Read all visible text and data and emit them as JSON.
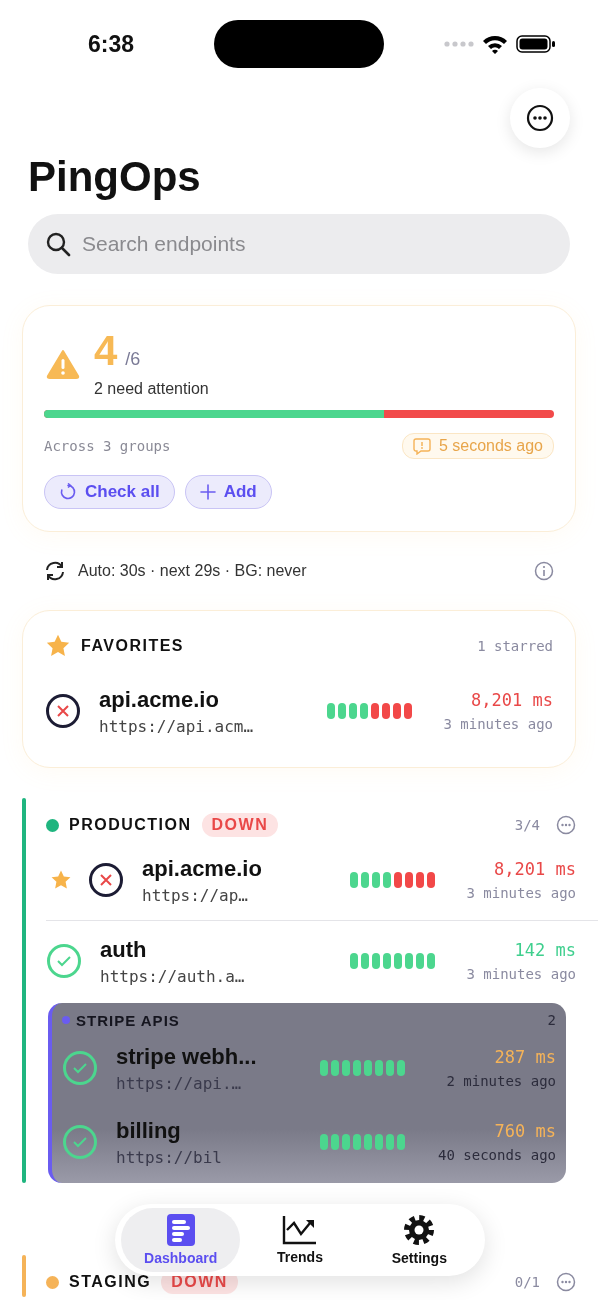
{
  "status_bar": {
    "time": "6:38"
  },
  "title": "PingOps",
  "search": {
    "placeholder": "Search endpoints"
  },
  "summary": {
    "count": "4",
    "total": "/6",
    "subtitle": "2 need attention",
    "level": 0.667,
    "groups": "Across 3 groups",
    "updated": "5 seconds ago",
    "buttons": [
      {
        "label": "Check all",
        "kind": "refresh"
      },
      {
        "label": "Add",
        "kind": "add"
      }
    ]
  },
  "auto_refresh": "Auto: 30s · next 29s · BG: never",
  "favorites": {
    "title": "FAVORITES",
    "count": "1 starred",
    "endpoints": [
      {
        "name": "api.acme.io",
        "url": "https://api.acm…",
        "down": true,
        "starred": false,
        "checks": [
          true,
          true,
          true,
          true,
          false,
          false,
          false,
          false
        ],
        "latency": "8,201 ms",
        "color": "#e94848",
        "ago": "3 minutes ago"
      }
    ]
  },
  "groups": [
    {
      "name": "PRODUCTION",
      "color": "#1fb57f",
      "badge": "DOWN",
      "count": "3/4",
      "endpoints": [
        {
          "name": "api.acme.io",
          "url": "https://ap…",
          "down": true,
          "starred": true,
          "checks": [
            true,
            true,
            true,
            true,
            false,
            false,
            false,
            false
          ],
          "latency": "8,201 ms",
          "color": "#e94848",
          "ago": "3 minutes ago"
        },
        {
          "name": "auth",
          "url": "https://auth.a…",
          "down": false,
          "starred": false,
          "checks": [
            true,
            true,
            true,
            true,
            true,
            true,
            true,
            true
          ],
          "latency": "142 ms",
          "color": "#3fcf8e",
          "ago": "3 minutes ago"
        }
      ],
      "subgroups": [
        {
          "name": "STRIPE APIS",
          "color": "#6a5cf0",
          "count": "2",
          "endpoints": [
            {
              "name": "stripe webh...",
              "url": "https://api.…",
              "down": false,
              "starred": false,
              "checks": [
                true,
                true,
                true,
                true,
                true,
                true,
                true,
                true
              ],
              "latency": "287 ms",
              "color": "#f5b358",
              "ago": "2 minutes ago"
            },
            {
              "name": "billing",
              "url": "https://bil",
              "down": false,
              "starred": false,
              "checks": [
                true,
                true,
                true,
                true,
                true,
                true,
                true,
                true
              ],
              "latency": "760 ms",
              "color": "#f5b358",
              "ago": "40 seconds ago"
            }
          ]
        }
      ]
    },
    {
      "name": "STAGING",
      "color": "#f5b358",
      "badge": "DOWN",
      "count": "0/1"
    }
  ],
  "tabs": [
    {
      "label": "Dashboard",
      "kind": "dashboard",
      "selected": true
    },
    {
      "label": "Trends",
      "kind": "trends",
      "selected": false
    },
    {
      "label": "Settings",
      "kind": "settings",
      "selected": false
    }
  ]
}
